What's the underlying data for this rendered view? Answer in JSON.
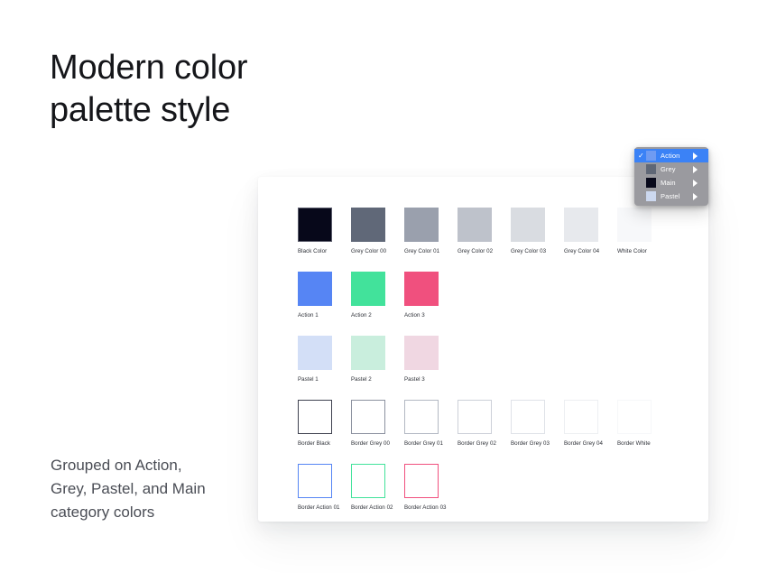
{
  "headline": {
    "line1": "Modern color",
    "line2": "palette style"
  },
  "caption": {
    "line1": "Grouped on Action,",
    "line2": "Grey, Pastel, and Main",
    "line3": "category colors"
  },
  "context_menu": {
    "selected_bg": "#3b82f6",
    "menu_bg": "#9a9a9f",
    "items": [
      {
        "label": "Action",
        "swatch": "#6f9bf2",
        "selected": true,
        "check": "✓",
        "has_submenu": true
      },
      {
        "label": "Grey",
        "swatch": "#5f6776",
        "selected": false,
        "check": "",
        "has_submenu": true
      },
      {
        "label": "Main",
        "swatch": "#07081a",
        "selected": false,
        "check": "",
        "has_submenu": true
      },
      {
        "label": "Pastel",
        "swatch": "#ccd8ef",
        "selected": false,
        "check": "",
        "has_submenu": true
      }
    ]
  },
  "palette": {
    "rows": [
      {
        "name": "main-and-greys",
        "swatches": [
          {
            "label": "Black Color",
            "fill": "#07081a",
            "border": "#5a5c6b",
            "type": "fill"
          },
          {
            "label": "Grey Color 00",
            "fill": "#606878",
            "border": "",
            "type": "fill"
          },
          {
            "label": "Grey Color 01",
            "fill": "#9aa0ad",
            "border": "",
            "type": "fill"
          },
          {
            "label": "Grey Color 02",
            "fill": "#bec2cb",
            "border": "",
            "type": "fill"
          },
          {
            "label": "Grey Color 03",
            "fill": "#d9dce1",
            "border": "",
            "type": "fill"
          },
          {
            "label": "Grey Color 04",
            "fill": "#e7e9ed",
            "border": "",
            "type": "fill"
          },
          {
            "label": "White Color",
            "fill": "#f7f8fa",
            "border": "",
            "type": "fill"
          }
        ]
      },
      {
        "name": "action",
        "swatches": [
          {
            "label": "Action 1",
            "fill": "#5685f4",
            "border": "",
            "type": "fill"
          },
          {
            "label": "Action 2",
            "fill": "#42e29b",
            "border": "",
            "type": "fill"
          },
          {
            "label": "Action 3",
            "fill": "#f0507e",
            "border": "",
            "type": "fill"
          }
        ]
      },
      {
        "name": "pastel",
        "swatches": [
          {
            "label": "Pastel 1",
            "fill": "#d3dff7",
            "border": "",
            "type": "fill"
          },
          {
            "label": "Pastel 2",
            "fill": "#c9eedd",
            "border": "",
            "type": "fill"
          },
          {
            "label": "Pastel 3",
            "fill": "#f0d7e2",
            "border": "",
            "type": "fill"
          }
        ]
      },
      {
        "name": "borders-grey",
        "swatches": [
          {
            "label": "Border Black",
            "fill": "#ffffff",
            "border": "#3f4250",
            "type": "border"
          },
          {
            "label": "Border Grey 00",
            "fill": "#ffffff",
            "border": "#8b919f",
            "type": "border"
          },
          {
            "label": "Border Grey 01",
            "fill": "#ffffff",
            "border": "#b3b8c3",
            "type": "border"
          },
          {
            "label": "Border Grey 02",
            "fill": "#ffffff",
            "border": "#ccd0d8",
            "type": "border"
          },
          {
            "label": "Border Grey 03",
            "fill": "#ffffff",
            "border": "#dfe2e8",
            "type": "border"
          },
          {
            "label": "Border Grey 04",
            "fill": "#ffffff",
            "border": "#edeff2",
            "type": "border"
          },
          {
            "label": "Border White",
            "fill": "#ffffff",
            "border": "#f6f7f9",
            "type": "border"
          }
        ]
      },
      {
        "name": "borders-action",
        "swatches": [
          {
            "label": "Border Action 01",
            "fill": "#ffffff",
            "border": "#5685f4",
            "type": "border"
          },
          {
            "label": "Border Action 02",
            "fill": "#ffffff",
            "border": "#42e29b",
            "type": "border"
          },
          {
            "label": "Border Action 03",
            "fill": "#ffffff",
            "border": "#f0507e",
            "type": "border"
          }
        ]
      }
    ]
  }
}
